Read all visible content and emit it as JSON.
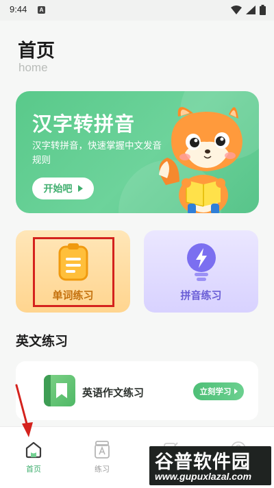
{
  "status_bar": {
    "time": "9:44",
    "notification_badge": "A",
    "icons": [
      "wifi-icon",
      "signal-icon",
      "battery-icon"
    ]
  },
  "header": {
    "title": "首页",
    "subtitle": "home"
  },
  "banner": {
    "title": "汉字转拼音",
    "description": "汉字转拼音，快速掌握中文发音规则",
    "button_label": "开始吧",
    "illustration": "fox-reading-book"
  },
  "practice_cards": [
    {
      "label": "单词练习",
      "icon": "notepad-icon",
      "accent": "#c4710d"
    },
    {
      "label": "拼音练习",
      "icon": "lightbulb-icon",
      "accent": "#6a5ed6"
    }
  ],
  "english_section": {
    "title": "英文练习",
    "items": [
      {
        "title": "英语作文练习",
        "button_label": "立刻学习",
        "icon": "book-icon"
      }
    ]
  },
  "bottom_nav": {
    "items": [
      {
        "label": "首页",
        "icon": "home-icon",
        "active": true
      },
      {
        "label": "练习",
        "icon": "practice-icon",
        "active": false
      }
    ]
  },
  "watermark": {
    "title": "谷普软件园",
    "url": "www.gupuxlazal.com"
  },
  "colors": {
    "primary_green": "#59c98a",
    "active_nav": "#3fae6e",
    "annotation_red": "#d4221d"
  }
}
